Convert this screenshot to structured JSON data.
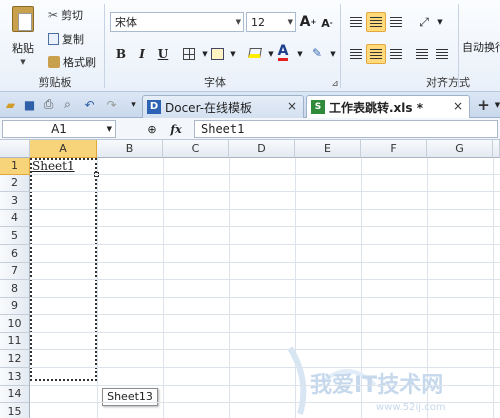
{
  "ribbon": {
    "clipboard": {
      "paste_label": "粘贴",
      "cut_label": "剪切",
      "copy_label": "复制",
      "format_painter_label": "格式刷",
      "group_label": "剪贴板"
    },
    "font": {
      "font_name": "宋体",
      "font_size": "12",
      "bold": "B",
      "italic": "I",
      "underline": "U",
      "grow": "A",
      "shrink": "A",
      "font_color_letter": "A",
      "group_label": "字体"
    },
    "alignment": {
      "group_label": "对齐方式",
      "wrap_label": "自动换行"
    },
    "colors": {
      "accent_yellow": "#ffd97a",
      "font_red": "#e0201c",
      "fill_yellow": "#ffee00"
    }
  },
  "tabs": [
    {
      "label": "Docer-在线模板",
      "active": false
    },
    {
      "label": "工作表跳转.xls *",
      "active": true
    }
  ],
  "formula_bar": {
    "name_box": "A1",
    "fx": "fx",
    "value": "Sheet1"
  },
  "grid": {
    "columns": [
      "A",
      "B",
      "C",
      "D",
      "E",
      "F",
      "G"
    ],
    "rows": [
      "1",
      "2",
      "3",
      "4",
      "5",
      "6",
      "7",
      "8",
      "9",
      "10",
      "11",
      "12",
      "13",
      "14",
      "15"
    ],
    "cell_a1": "Sheet1"
  },
  "tooltip": "Sheet13",
  "watermark": {
    "text": "我爱IT技术网",
    "url": "www.52ij.com"
  }
}
